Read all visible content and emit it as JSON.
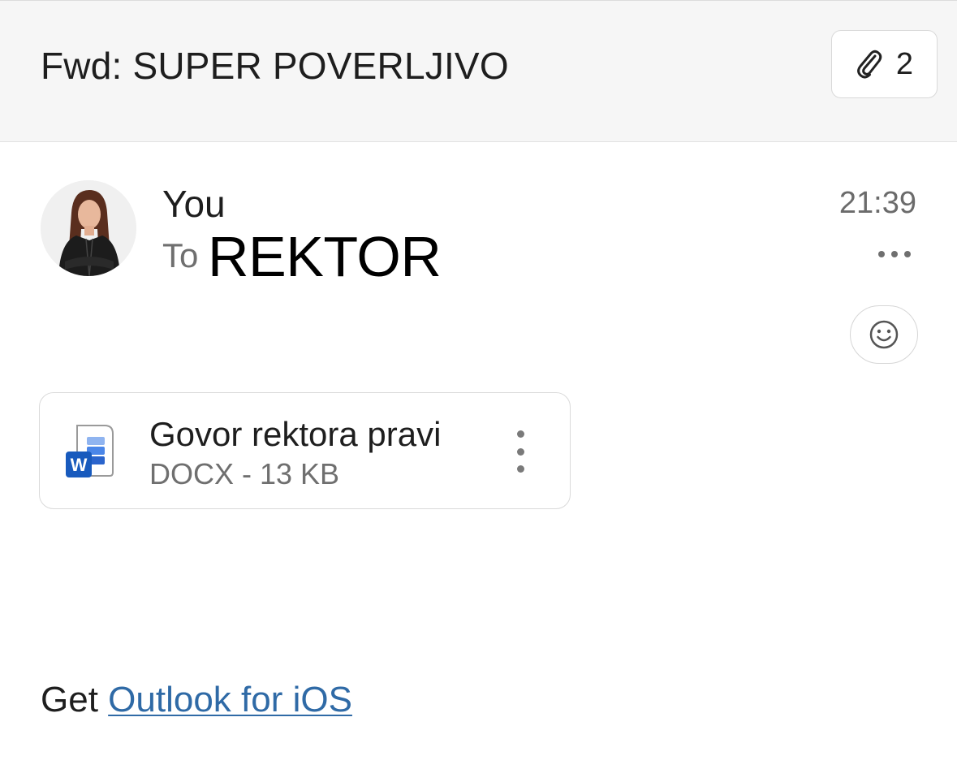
{
  "header": {
    "subject": "Fwd: SUPER POVERLJIVO",
    "attachment_count": "2",
    "attachment_icon": "paperclip-icon"
  },
  "message": {
    "sender": "You",
    "to_label": "To",
    "recipient": "REKTOR",
    "time": "21:39",
    "more_icon": "more-horizontal-icon",
    "reaction_icon": "smiley-icon"
  },
  "attachment": {
    "file_name": "Govor rektora pravi",
    "file_meta": "DOCX - 13 KB",
    "icon": "word-document-icon",
    "menu_icon": "more-vertical-icon"
  },
  "signature": {
    "prefix": "Get",
    "link_text": "Outlook for iOS"
  },
  "colors": {
    "header_bg": "#f6f6f6",
    "link": "#2f6aa6",
    "word_blue": "#185abd"
  }
}
